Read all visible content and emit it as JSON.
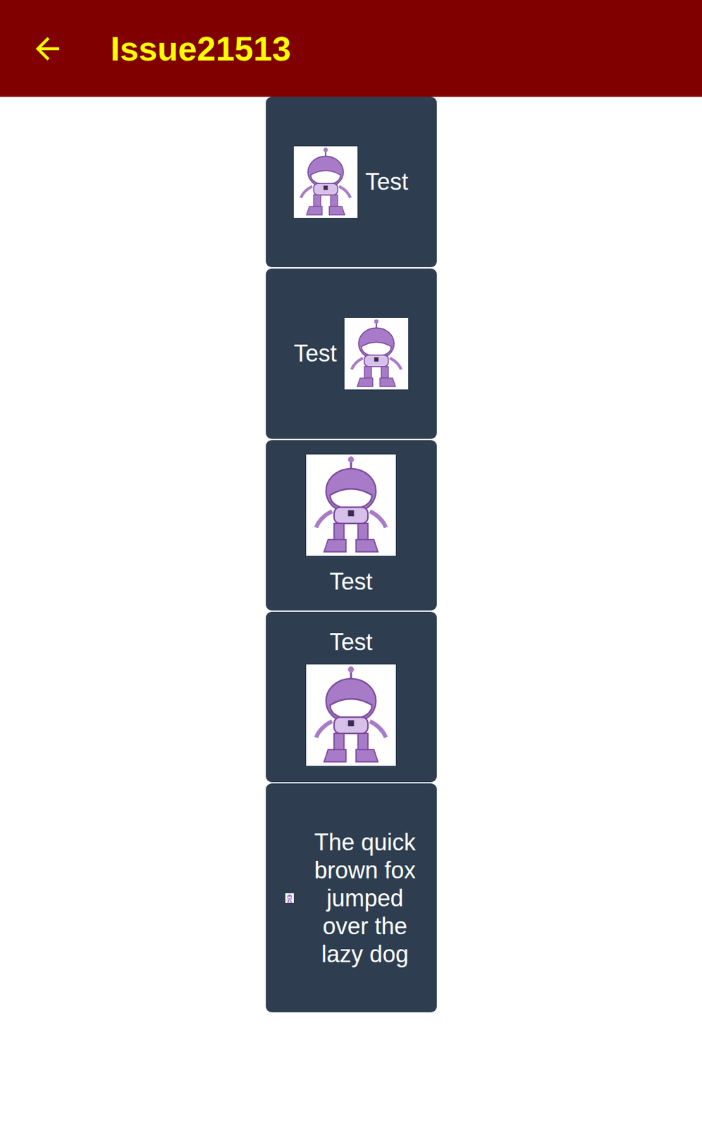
{
  "window": {
    "title": "Issue21513"
  },
  "toolbar": {
    "back_icon": true
  },
  "buttons": [
    {
      "text": "Test",
      "kind": "left"
    },
    {
      "text": "Test",
      "kind": "right"
    },
    {
      "text": "Test",
      "kind": "top"
    },
    {
      "text": "Test",
      "kind": "bottom"
    },
    {
      "text": "The quick brown fox jumped over the lazy dog",
      "kind": "tiny"
    }
  ]
}
